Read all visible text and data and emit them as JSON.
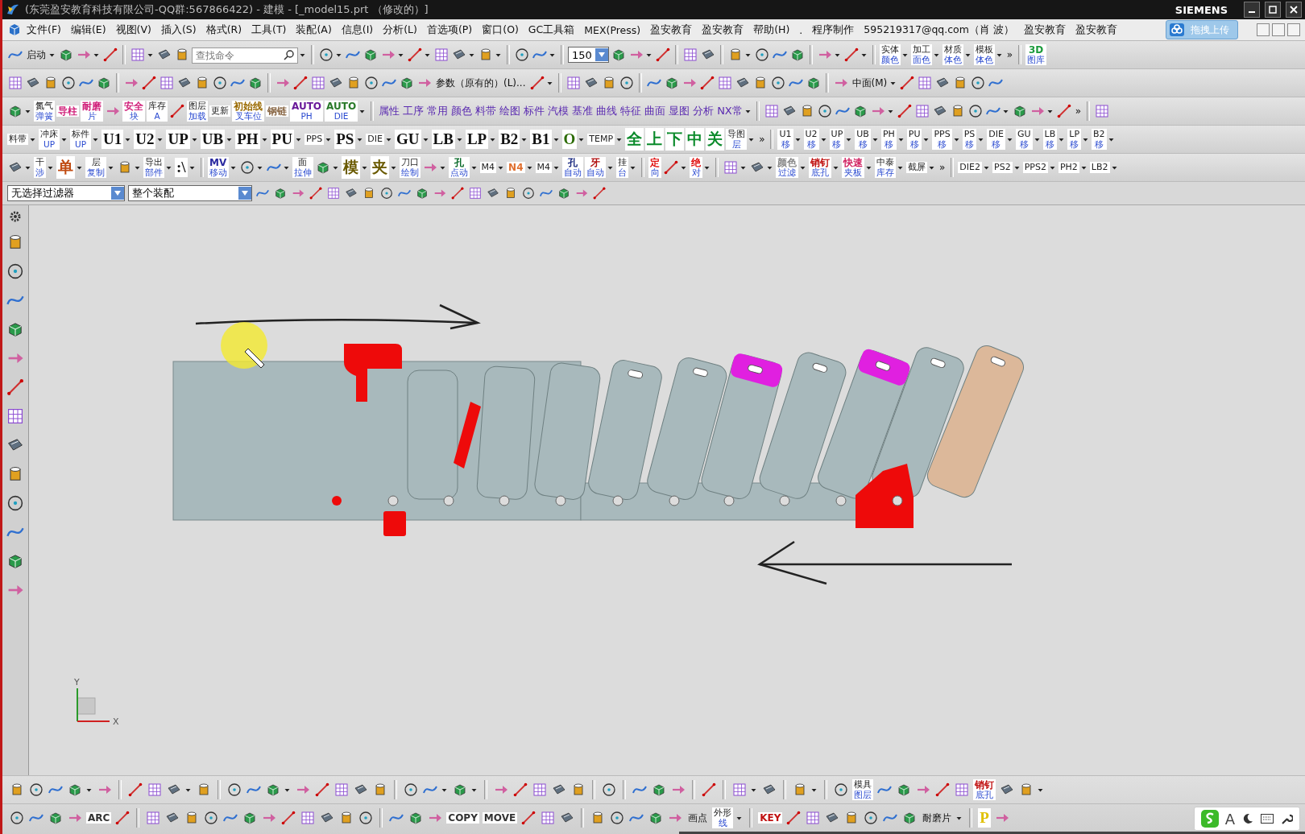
{
  "window": {
    "title": "(东莞盈安教育科技有限公司-QQ群:567866422) - 建模 - [_model15.prt （修改的）]",
    "brand": "SIEMENS"
  },
  "menu": [
    "文件(F)",
    "编辑(E)",
    "视图(V)",
    "插入(S)",
    "格式(R)",
    "工具(T)",
    "装配(A)",
    "信息(I)",
    "分析(L)",
    "首选项(P)",
    "窗口(O)",
    "GC工具箱",
    "MEX(Press)",
    "盈安教育",
    "盈安教育",
    "帮助(H)",
    ".",
    "程序制作",
    "595219317@qq.com（肖 波）",
    "盈安教育",
    "盈安教育"
  ],
  "upload_button": "拖拽上传",
  "toolbars": [
    [
      {
        "kind": "icon"
      },
      {
        "kind": "text",
        "label": "启动",
        "caret": true
      },
      {
        "kind": "icon"
      },
      {
        "kind": "icon",
        "caret": true
      },
      {
        "kind": "icon"
      },
      {
        "kind": "sep"
      },
      {
        "kind": "icon",
        "caret": true
      },
      {
        "kind": "icon"
      },
      {
        "kind": "icon"
      },
      {
        "kind": "search",
        "placeholder": "查找命令",
        "caret": true
      },
      {
        "kind": "sep"
      },
      {
        "kind": "icon",
        "caret": true
      },
      {
        "kind": "icon"
      },
      {
        "kind": "icon"
      },
      {
        "kind": "icon",
        "caret": true
      },
      {
        "kind": "icon",
        "caret": true
      },
      {
        "kind": "icon"
      },
      {
        "kind": "icon",
        "caret": true
      },
      {
        "kind": "icon",
        "caret": true
      },
      {
        "kind": "sep"
      },
      {
        "kind": "icon"
      },
      {
        "kind": "icon",
        "caret": true
      },
      {
        "kind": "sep"
      },
      {
        "kind": "combo",
        "value": "150"
      },
      {
        "kind": "icon"
      },
      {
        "kind": "icon",
        "caret": true
      },
      {
        "kind": "icon"
      },
      {
        "kind": "sep"
      },
      {
        "kind": "icon"
      },
      {
        "kind": "icon"
      },
      {
        "kind": "sep"
      },
      {
        "kind": "icon",
        "caret": true
      },
      {
        "kind": "icon"
      },
      {
        "kind": "icon"
      },
      {
        "kind": "icon"
      },
      {
        "kind": "sep"
      },
      {
        "kind": "icon",
        "caret": true
      },
      {
        "kind": "icon",
        "caret": true
      },
      {
        "kind": "sep"
      },
      {
        "kind": "tile",
        "label": "实体",
        "sub": "颜色",
        "caret": true
      },
      {
        "kind": "tile",
        "label": "加工",
        "sub": "面色",
        "caret": true
      },
      {
        "kind": "tile",
        "label": "材质",
        "sub": "体色",
        "caret": true
      },
      {
        "kind": "tile",
        "label": "模板",
        "sub": "体色",
        "caret": true
      },
      {
        "kind": "text",
        "label": "»"
      },
      {
        "kind": "sep"
      },
      {
        "kind": "tile",
        "label": "3D",
        "sub": "图库",
        "color": "#1a9a3a"
      }
    ],
    [
      {
        "kind": "icon"
      },
      {
        "kind": "icon"
      },
      {
        "kind": "icon"
      },
      {
        "kind": "icon"
      },
      {
        "kind": "icon"
      },
      {
        "kind": "icon"
      },
      {
        "kind": "sep"
      },
      {
        "kind": "icon"
      },
      {
        "kind": "icon"
      },
      {
        "kind": "icon"
      },
      {
        "kind": "icon"
      },
      {
        "kind": "icon"
      },
      {
        "kind": "icon"
      },
      {
        "kind": "icon"
      },
      {
        "kind": "icon"
      },
      {
        "kind": "sep"
      },
      {
        "kind": "icon"
      },
      {
        "kind": "icon"
      },
      {
        "kind": "icon"
      },
      {
        "kind": "icon"
      },
      {
        "kind": "icon"
      },
      {
        "kind": "icon"
      },
      {
        "kind": "icon"
      },
      {
        "kind": "icon"
      },
      {
        "kind": "icon"
      },
      {
        "kind": "text",
        "label": "参数（原有的）(L)..."
      },
      {
        "kind": "icon",
        "caret": true
      },
      {
        "kind": "sep"
      },
      {
        "kind": "icon"
      },
      {
        "kind": "icon"
      },
      {
        "kind": "icon"
      },
      {
        "kind": "icon"
      },
      {
        "kind": "sep"
      },
      {
        "kind": "icon"
      },
      {
        "kind": "icon"
      },
      {
        "kind": "icon"
      },
      {
        "kind": "icon"
      },
      {
        "kind": "icon"
      },
      {
        "kind": "icon"
      },
      {
        "kind": "icon"
      },
      {
        "kind": "icon"
      },
      {
        "kind": "icon"
      },
      {
        "kind": "icon"
      },
      {
        "kind": "sep"
      },
      {
        "kind": "icon"
      },
      {
        "kind": "text",
        "label": "中面(M)",
        "caret": true
      },
      {
        "kind": "icon"
      },
      {
        "kind": "icon"
      },
      {
        "kind": "icon"
      },
      {
        "kind": "icon"
      },
      {
        "kind": "icon"
      },
      {
        "kind": "icon"
      }
    ],
    [
      {
        "kind": "icon",
        "caret": true
      },
      {
        "kind": "tile",
        "label": "氮气",
        "sub": "弹簧"
      },
      {
        "kind": "tile",
        "label": "导柱",
        "color": "#d0207a"
      },
      {
        "kind": "tile",
        "label": "耐磨",
        "sub": "片",
        "color": "#d0207a"
      },
      {
        "kind": "icon"
      },
      {
        "kind": "tile",
        "label": "安全",
        "sub": "块",
        "color": "#d0207a"
      },
      {
        "kind": "tile",
        "label": "库存",
        "sub": "A"
      },
      {
        "kind": "icon"
      },
      {
        "kind": "tile",
        "label": "图层",
        "sub": "加载"
      },
      {
        "kind": "tile",
        "label": "更新"
      },
      {
        "kind": "tile",
        "label": "初始线",
        "sub": "叉车位",
        "color": "#9a6a00"
      },
      {
        "kind": "tile",
        "label": "钢链",
        "color": "#886644"
      },
      {
        "kind": "tile",
        "label": "AUTO",
        "sub": "PH",
        "color": "#6a1a9a"
      },
      {
        "kind": "tile",
        "label": "AUTO",
        "sub": "DIE",
        "color": "#2a7a2a",
        "caret": true
      },
      {
        "kind": "sep"
      },
      {
        "kind": "word",
        "label": "属性"
      },
      {
        "kind": "word",
        "label": "工序"
      },
      {
        "kind": "word",
        "label": "常用"
      },
      {
        "kind": "word",
        "label": "颜色"
      },
      {
        "kind": "word",
        "label": "料带"
      },
      {
        "kind": "word",
        "label": "绘图"
      },
      {
        "kind": "word",
        "label": "标件"
      },
      {
        "kind": "word",
        "label": "汽模"
      },
      {
        "kind": "word",
        "label": "基准"
      },
      {
        "kind": "word",
        "label": "曲线"
      },
      {
        "kind": "word",
        "label": "特征"
      },
      {
        "kind": "word",
        "label": "曲面"
      },
      {
        "kind": "word",
        "label": "显图"
      },
      {
        "kind": "word",
        "label": "分析"
      },
      {
        "kind": "word",
        "label": "NX常",
        "caret": true
      },
      {
        "kind": "sep"
      },
      {
        "kind": "icon"
      },
      {
        "kind": "icon"
      },
      {
        "kind": "icon"
      },
      {
        "kind": "icon"
      },
      {
        "kind": "icon"
      },
      {
        "kind": "icon"
      },
      {
        "kind": "icon",
        "caret": true
      },
      {
        "kind": "icon"
      },
      {
        "kind": "icon"
      },
      {
        "kind": "icon"
      },
      {
        "kind": "icon"
      },
      {
        "kind": "icon"
      },
      {
        "kind": "icon",
        "caret": true
      },
      {
        "kind": "icon"
      },
      {
        "kind": "icon",
        "caret": true
      },
      {
        "kind": "icon"
      },
      {
        "kind": "text",
        "label": "»"
      },
      {
        "kind": "sep"
      },
      {
        "kind": "icon"
      }
    ],
    [
      {
        "kind": "tile",
        "label": "料带",
        "caret": true
      },
      {
        "kind": "tile",
        "label": "冲床",
        "sub": "UP",
        "caret": true
      },
      {
        "kind": "tile",
        "label": "标件",
        "sub": "UP",
        "caret": true
      },
      {
        "kind": "big",
        "label": "U1",
        "caret": true
      },
      {
        "kind": "big",
        "label": "U2",
        "caret": true
      },
      {
        "kind": "big",
        "label": "UP",
        "caret": true
      },
      {
        "kind": "big",
        "label": "UB",
        "caret": true
      },
      {
        "kind": "big",
        "label": "PH",
        "caret": true
      },
      {
        "kind": "big",
        "label": "PU",
        "caret": true
      },
      {
        "kind": "tile",
        "label": "PPS",
        "caret": true
      },
      {
        "kind": "big",
        "label": "PS",
        "caret": true
      },
      {
        "kind": "tile",
        "label": "DIE",
        "caret": true
      },
      {
        "kind": "big",
        "label": "GU",
        "caret": true
      },
      {
        "kind": "big",
        "label": "LB",
        "caret": true
      },
      {
        "kind": "big",
        "label": "LP",
        "caret": true
      },
      {
        "kind": "big",
        "label": "B2",
        "caret": true
      },
      {
        "kind": "big",
        "label": "B1",
        "caret": true
      },
      {
        "kind": "big",
        "label": "O",
        "color": "#2a6a00",
        "caret": true
      },
      {
        "kind": "tile",
        "label": "TEMP",
        "caret": true
      },
      {
        "kind": "big",
        "label": "全",
        "color": "#0a8a2a"
      },
      {
        "kind": "big",
        "label": "上",
        "color": "#0a8a2a"
      },
      {
        "kind": "big",
        "label": "下",
        "color": "#0a8a2a"
      },
      {
        "kind": "big",
        "label": "中",
        "color": "#0a8a2a"
      },
      {
        "kind": "big",
        "label": "关",
        "color": "#0a8a2a"
      },
      {
        "kind": "tile",
        "label": "导图",
        "sub": "层",
        "caret": true
      },
      {
        "kind": "text",
        "label": "»"
      },
      {
        "kind": "sep"
      },
      {
        "kind": "tile",
        "label": "U1",
        "sub": "移",
        "caret": true
      },
      {
        "kind": "tile",
        "label": "U2",
        "sub": "移",
        "caret": true
      },
      {
        "kind": "tile",
        "label": "UP",
        "sub": "移",
        "caret": true
      },
      {
        "kind": "tile",
        "label": "UB",
        "sub": "移",
        "caret": true
      },
      {
        "kind": "tile",
        "label": "PH",
        "sub": "移",
        "caret": true
      },
      {
        "kind": "tile",
        "label": "PU",
        "sub": "移",
        "caret": true
      },
      {
        "kind": "tile",
        "label": "PPS",
        "sub": "移",
        "caret": true
      },
      {
        "kind": "tile",
        "label": "PS",
        "sub": "移",
        "caret": true
      },
      {
        "kind": "tile",
        "label": "DIE",
        "sub": "移",
        "caret": true
      },
      {
        "kind": "tile",
        "label": "GU",
        "sub": "移",
        "caret": true
      },
      {
        "kind": "tile",
        "label": "LB",
        "sub": "移",
        "caret": true
      },
      {
        "kind": "tile",
        "label": "LP",
        "sub": "移",
        "caret": true
      },
      {
        "kind": "tile",
        "label": "B2",
        "sub": "移",
        "caret": true
      }
    ],
    [
      {
        "kind": "icon",
        "caret": true
      },
      {
        "kind": "tile",
        "label": "干",
        "sub": "涉",
        "caret": true
      },
      {
        "kind": "big",
        "label": "单",
        "color": "#c04a10",
        "caret": true
      },
      {
        "kind": "tile",
        "label": "层",
        "sub": "复制",
        "caret": true
      },
      {
        "kind": "icon",
        "caret": true
      },
      {
        "kind": "tile",
        "label": "导出",
        "sub": "部件",
        "caret": true
      },
      {
        "kind": "big",
        "label": ":\\",
        "caret": true
      },
      {
        "kind": "sep"
      },
      {
        "kind": "tile",
        "label": "MV",
        "sub": "移动",
        "color": "#2a2aa0",
        "caret": true
      },
      {
        "kind": "icon",
        "caret": true
      },
      {
        "kind": "icon",
        "caret": true
      },
      {
        "kind": "tile",
        "label": "面",
        "sub": "拉伸"
      },
      {
        "kind": "icon",
        "caret": true
      },
      {
        "kind": "big",
        "label": "模",
        "color": "#6a5a00",
        "caret": true
      },
      {
        "kind": "big",
        "label": "夹",
        "color": "#6a5a00",
        "caret": true
      },
      {
        "kind": "tile",
        "label": "刀口",
        "sub": "绘制"
      },
      {
        "kind": "icon",
        "caret": true
      },
      {
        "kind": "tile",
        "label": "孔",
        "sub": "点动",
        "color": "#0a6a2a",
        "caret": true
      },
      {
        "kind": "tile",
        "label": "M4",
        "caret": true
      },
      {
        "kind": "tile",
        "label": "N4",
        "color": "#e07030",
        "caret": true
      },
      {
        "kind": "tile",
        "label": "M4",
        "caret": true
      },
      {
        "kind": "tile",
        "label": "孔",
        "sub": "自动",
        "color": "#1a2a80"
      },
      {
        "kind": "tile",
        "label": "牙",
        "sub": "自动",
        "color": "#b01010",
        "caret": true
      },
      {
        "kind": "tile",
        "label": "挂",
        "sub": "台",
        "caret": true
      },
      {
        "kind": "sep"
      },
      {
        "kind": "tile",
        "label": "定",
        "sub": "向",
        "color": "#e01010"
      },
      {
        "kind": "icon",
        "caret": true
      },
      {
        "kind": "tile",
        "label": "绝",
        "sub": "对",
        "color": "#e01010",
        "caret": true
      },
      {
        "kind": "sep"
      },
      {
        "kind": "icon",
        "caret": true
      },
      {
        "kind": "icon",
        "caret": true
      },
      {
        "kind": "tile",
        "label": "颜色",
        "sub": "过滤",
        "color": "#888888",
        "caret": true
      },
      {
        "kind": "tile",
        "label": "销钉",
        "sub": "底孔",
        "color": "#c01010",
        "caret": true
      },
      {
        "kind": "tile",
        "label": "快速",
        "sub": "夹板",
        "color": "#d02060",
        "caret": true
      },
      {
        "kind": "tile",
        "label": "中泰",
        "sub": "库存",
        "caret": true
      },
      {
        "kind": "tile",
        "label": "截屏",
        "caret": true
      },
      {
        "kind": "text",
        "label": "»"
      },
      {
        "kind": "sep"
      },
      {
        "kind": "tile",
        "label": "DIE2",
        "caret": true
      },
      {
        "kind": "tile",
        "label": "PS2",
        "caret": true
      },
      {
        "kind": "tile",
        "label": "PPS2",
        "caret": true
      },
      {
        "kind": "tile",
        "label": "PH2",
        "caret": true
      },
      {
        "kind": "tile",
        "label": "LB2",
        "caret": true
      }
    ]
  ],
  "selection_bar": {
    "filter": "无选择过滤器",
    "scope": "整个装配"
  },
  "axes": {
    "x": "X",
    "y": "Y"
  },
  "bottom_toolbars": [
    [
      {
        "kind": "icon"
      },
      {
        "kind": "icon"
      },
      {
        "kind": "icon"
      },
      {
        "kind": "icon",
        "caret": true
      },
      {
        "kind": "icon"
      },
      {
        "kind": "sep"
      },
      {
        "kind": "icon"
      },
      {
        "kind": "icon"
      },
      {
        "kind": "icon",
        "caret": true
      },
      {
        "kind": "icon"
      },
      {
        "kind": "sep"
      },
      {
        "kind": "icon"
      },
      {
        "kind": "icon"
      },
      {
        "kind": "icon",
        "caret": true
      },
      {
        "kind": "icon"
      },
      {
        "kind": "icon"
      },
      {
        "kind": "icon"
      },
      {
        "kind": "icon"
      },
      {
        "kind": "icon"
      },
      {
        "kind": "sep"
      },
      {
        "kind": "icon"
      },
      {
        "kind": "icon",
        "caret": true
      },
      {
        "kind": "icon",
        "caret": true
      },
      {
        "kind": "sep"
      },
      {
        "kind": "icon"
      },
      {
        "kind": "icon"
      },
      {
        "kind": "icon"
      },
      {
        "kind": "icon"
      },
      {
        "kind": "icon"
      },
      {
        "kind": "sep"
      },
      {
        "kind": "icon"
      },
      {
        "kind": "sep"
      },
      {
        "kind": "icon"
      },
      {
        "kind": "icon"
      },
      {
        "kind": "icon"
      },
      {
        "kind": "sep"
      },
      {
        "kind": "icon"
      },
      {
        "kind": "sep"
      },
      {
        "kind": "icon",
        "caret": true
      },
      {
        "kind": "icon"
      },
      {
        "kind": "sep"
      },
      {
        "kind": "icon",
        "caret": true
      },
      {
        "kind": "sep"
      },
      {
        "kind": "icon"
      },
      {
        "kind": "tile",
        "label": "模具",
        "sub": "图层"
      },
      {
        "kind": "icon"
      },
      {
        "kind": "icon"
      },
      {
        "kind": "icon"
      },
      {
        "kind": "icon"
      },
      {
        "kind": "icon"
      },
      {
        "kind": "tile",
        "label": "销钉",
        "sub": "底孔",
        "color": "#c01010"
      },
      {
        "kind": "icon"
      },
      {
        "kind": "icon",
        "caret": true
      }
    ],
    [
      {
        "kind": "icon"
      },
      {
        "kind": "icon"
      },
      {
        "kind": "icon"
      },
      {
        "kind": "icon"
      },
      {
        "kind": "tile",
        "label": "ARC",
        "color": "#333333"
      },
      {
        "kind": "icon"
      },
      {
        "kind": "sep"
      },
      {
        "kind": "icon"
      },
      {
        "kind": "icon"
      },
      {
        "kind": "icon"
      },
      {
        "kind": "icon"
      },
      {
        "kind": "icon"
      },
      {
        "kind": "icon"
      },
      {
        "kind": "icon"
      },
      {
        "kind": "icon"
      },
      {
        "kind": "icon"
      },
      {
        "kind": "icon"
      },
      {
        "kind": "icon"
      },
      {
        "kind": "icon"
      },
      {
        "kind": "sep"
      },
      {
        "kind": "icon"
      },
      {
        "kind": "icon"
      },
      {
        "kind": "icon"
      },
      {
        "kind": "tile",
        "label": "COPY",
        "color": "#333333"
      },
      {
        "kind": "tile",
        "label": "MOVE",
        "color": "#333333"
      },
      {
        "kind": "icon"
      },
      {
        "kind": "icon"
      },
      {
        "kind": "icon"
      },
      {
        "kind": "sep"
      },
      {
        "kind": "icon"
      },
      {
        "kind": "icon"
      },
      {
        "kind": "icon"
      },
      {
        "kind": "icon"
      },
      {
        "kind": "icon"
      },
      {
        "kind": "text",
        "label": "画点"
      },
      {
        "kind": "tile",
        "label": "外形",
        "sub": "线",
        "caret": true
      },
      {
        "kind": "sep"
      },
      {
        "kind": "tile",
        "label": "KEY",
        "color": "#c01010"
      },
      {
        "kind": "icon"
      },
      {
        "kind": "icon"
      },
      {
        "kind": "icon"
      },
      {
        "kind": "icon"
      },
      {
        "kind": "icon"
      },
      {
        "kind": "icon"
      },
      {
        "kind": "icon"
      },
      {
        "kind": "text",
        "label": "耐磨片",
        "caret": true
      },
      {
        "kind": "sep"
      },
      {
        "kind": "big",
        "label": "P",
        "color": "#e0c000"
      },
      {
        "kind": "icon"
      }
    ]
  ],
  "ime_bar": {
    "label": "A"
  }
}
